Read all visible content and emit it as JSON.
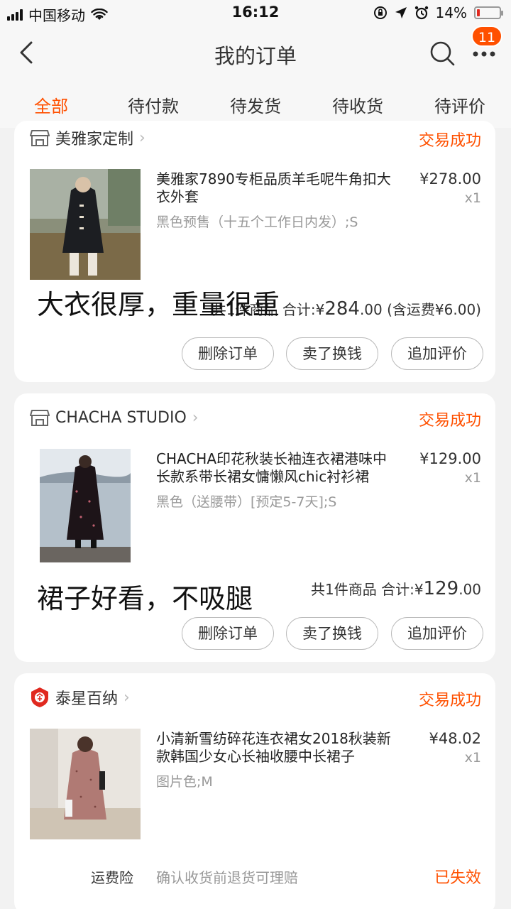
{
  "status_bar": {
    "carrier": "中国移动",
    "time": "16:12",
    "battery": "14%",
    "battery_level": 0.14
  },
  "nav": {
    "title": "我的订单",
    "badge": "11",
    "icons": [
      "back-icon",
      "search-icon",
      "more-icon"
    ]
  },
  "tabs": [
    {
      "label": "全部"
    },
    {
      "label": "待付款"
    },
    {
      "label": "待发货"
    },
    {
      "label": "待收货"
    },
    {
      "label": "待评价"
    }
  ],
  "colors": {
    "accent": "#ff5000",
    "background": "#f2f2f2"
  },
  "orders": [
    {
      "shop": "美雅家定制",
      "status": "交易成功",
      "product_title": "美雅家7890专柜品质羊毛呢牛角扣大衣外套",
      "spec": "黑色预售（十五个工作日内发）;S",
      "price": "¥278.00",
      "qty": "x1",
      "total_prefix": "共1件商品 合计:",
      "total_currency": "¥",
      "total_int": "284",
      "total_dec": ".00",
      "total_suffix": "(含运费¥6.00)",
      "overlay": "大衣很厚，重量很重",
      "buttons": [
        "删除订单",
        "卖了换钱",
        "追加评价"
      ]
    },
    {
      "shop": "CHACHA STUDIO",
      "status": "交易成功",
      "product_title": "CHACHA印花秋装长袖连衣裙港味中长款系带长裙女慵懒风chic衬衫裙",
      "spec": "黑色（送腰带）[预定5-7天];S",
      "price": "¥129.00",
      "qty": "x1",
      "total_prefix": "共1件商品 合计:",
      "total_currency": "¥",
      "total_int": "129",
      "total_dec": ".00",
      "overlay": "裙子好看，不吸腿",
      "buttons": [
        "删除订单",
        "卖了换钱",
        "追加评价"
      ]
    },
    {
      "shop": "泰星百纳",
      "status": "交易成功",
      "product_title": "小清新雪纺碎花连衣裙女2018秋装新款韩国少女心长袖收腰中长裙子",
      "spec": "图片色;M",
      "price": "¥48.02",
      "qty": "x1",
      "insurance_label": "运费险",
      "insurance_desc": "确认收货前退货可理赔",
      "insurance_status": "已失效"
    }
  ]
}
